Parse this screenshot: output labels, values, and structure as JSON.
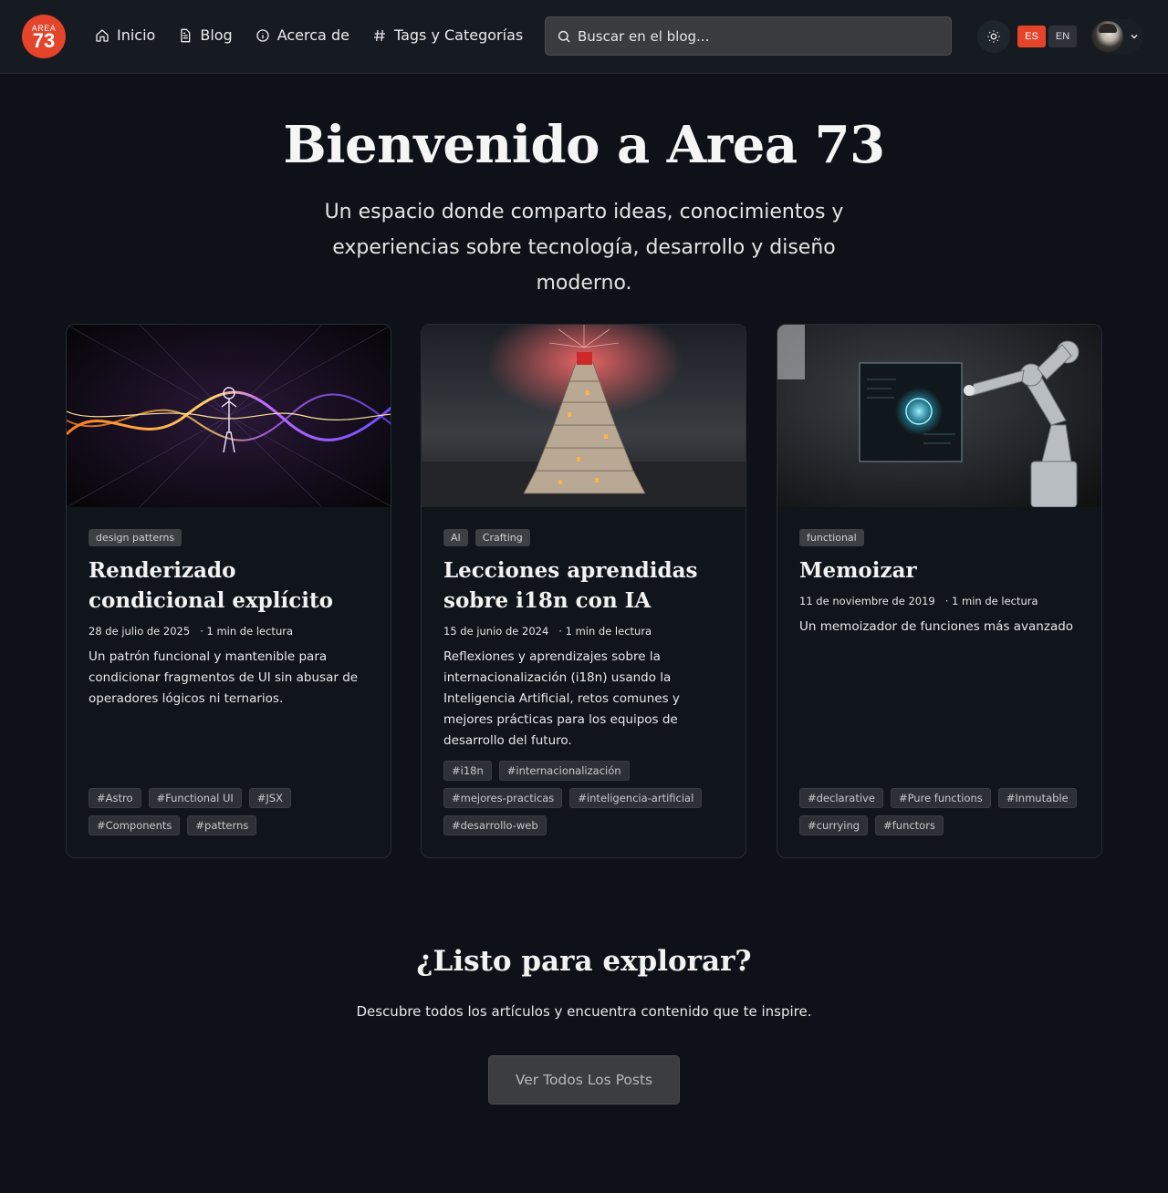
{
  "brand": {
    "logo_top": "AREA",
    "logo_main": "73"
  },
  "nav": [
    {
      "label": "Inicio",
      "icon": "home-icon"
    },
    {
      "label": "Blog",
      "icon": "document-icon"
    },
    {
      "label": "Acerca de",
      "icon": "info-icon"
    },
    {
      "label": "Tags y Categorías",
      "icon": "hash-icon"
    }
  ],
  "search": {
    "placeholder": "Buscar en el blog..."
  },
  "languages": {
    "es": "ES",
    "en": "EN",
    "active": "ES"
  },
  "colors": {
    "accent": "#e4442a",
    "background": "#0e1218",
    "header": "#161b22"
  },
  "hero": {
    "title": "Bienvenido a Area 73",
    "subtitle": "Un espacio donde comparto ideas, conocimientos y experiencias sobre tecnología, desarrollo y diseño moderno."
  },
  "posts": [
    {
      "categories": [
        "design patterns"
      ],
      "title": "Renderizado condicional explícito",
      "date": "28 de julio de 2025",
      "reading": "· 1 min de lectura",
      "description": "Un patrón funcional y mantenible para condicionar fragmentos de UI sin abusar de operadores lógicos ni ternarios.",
      "tags": [
        "#Astro",
        "#Functional UI",
        "#JSX",
        "#Components",
        "#patterns"
      ]
    },
    {
      "categories": [
        "AI",
        "Crafting"
      ],
      "title": "Lecciones aprendidas sobre i18n con IA",
      "date": "15 de junio de 2024",
      "reading": "· 1 min de lectura",
      "description": "Reflexiones y aprendizajes sobre la internacionalización (i18n) usando la Inteligencia Artificial, retos comunes y mejores prácticas para los equipos de desarrollo del futuro.",
      "tags": [
        "#i18n",
        "#internacionalización",
        "#mejores-practicas",
        "#inteligencia-artificial",
        "#desarrollo-web"
      ]
    },
    {
      "categories": [
        "functional"
      ],
      "title": "Memoizar",
      "date": "11 de noviembre de 2019",
      "reading": "· 1 min de lectura",
      "description": "Un memoizador de funciones más avanzado",
      "tags": [
        "#declarative",
        "#Pure functions",
        "#Inmutable",
        "#currying",
        "#functors"
      ]
    }
  ],
  "cta": {
    "title": "¿Listo para explorar?",
    "subtitle": "Descubre todos los artículos y encuentra contenido que te inspire.",
    "button": "Ver Todos Los Posts"
  }
}
